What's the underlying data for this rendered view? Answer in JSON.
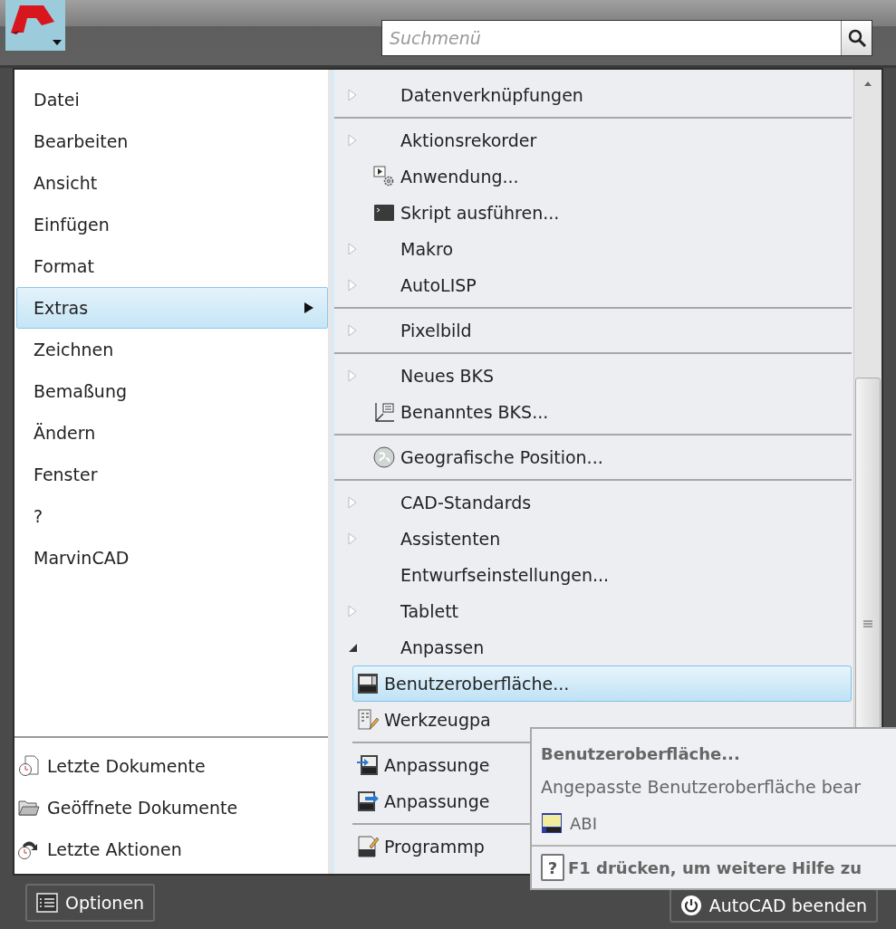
{
  "search": {
    "placeholder": "Suchmenü"
  },
  "menu": [
    {
      "label": "Datei",
      "selected": false
    },
    {
      "label": "Bearbeiten",
      "selected": false
    },
    {
      "label": "Ansicht",
      "selected": false
    },
    {
      "label": "Einfügen",
      "selected": false
    },
    {
      "label": "Format",
      "selected": false
    },
    {
      "label": "Extras",
      "selected": true
    },
    {
      "label": "Zeichnen",
      "selected": false
    },
    {
      "label": "Bemaßung",
      "selected": false
    },
    {
      "label": "Ändern",
      "selected": false
    },
    {
      "label": "Fenster",
      "selected": false
    },
    {
      "label": "?",
      "selected": false
    },
    {
      "label": "MarvinCAD",
      "selected": false
    }
  ],
  "documents": [
    {
      "label": "Letzte Dokumente"
    },
    {
      "label": "Geöffnete Dokumente"
    },
    {
      "label": "Letzte Aktionen"
    }
  ],
  "submenu": [
    {
      "kind": "submenu",
      "label": "Datenverknüpfungen",
      "selected": false
    },
    {
      "kind": "separator"
    },
    {
      "kind": "submenu",
      "label": "Aktionsrekorder",
      "selected": false
    },
    {
      "kind": "command",
      "label": "Anwendung...",
      "selected": false
    },
    {
      "kind": "command",
      "label": "Skript ausführen...",
      "selected": false
    },
    {
      "kind": "submenu",
      "label": "Makro",
      "selected": false
    },
    {
      "kind": "submenu",
      "label": "AutoLISP",
      "selected": false
    },
    {
      "kind": "separator"
    },
    {
      "kind": "submenu",
      "label": "Pixelbild",
      "selected": false
    },
    {
      "kind": "separator"
    },
    {
      "kind": "submenu",
      "label": "Neues BKS",
      "selected": false
    },
    {
      "kind": "command",
      "label": "Benanntes BKS...",
      "selected": false
    },
    {
      "kind": "separator"
    },
    {
      "kind": "command",
      "label": "Geografische Position...",
      "selected": false
    },
    {
      "kind": "separator"
    },
    {
      "kind": "submenu",
      "label": "CAD-Standards",
      "selected": false
    },
    {
      "kind": "submenu",
      "label": "Assistenten",
      "selected": false
    },
    {
      "kind": "command",
      "label": "Entwurfseinstellungen...",
      "selected": false
    },
    {
      "kind": "submenu",
      "label": "Tablett",
      "selected": false
    },
    {
      "kind": "expanded",
      "label": "Anpassen",
      "selected": false,
      "children": [
        {
          "kind": "command",
          "label": "Benutzeroberfläche...",
          "selected": true
        },
        {
          "kind": "command",
          "label": "Werkzeugpa",
          "selected": false
        },
        {
          "kind": "separator"
        },
        {
          "kind": "command",
          "label": "Anpassunge",
          "selected": false
        },
        {
          "kind": "command",
          "label": "Anpassunge",
          "selected": false
        },
        {
          "kind": "separator"
        },
        {
          "kind": "command",
          "label": "Programmp",
          "selected": false
        }
      ]
    }
  ],
  "tooltip": {
    "title": "Benutzeroberfläche...",
    "description": "Angepasste Benutzeroberfläche bear",
    "command": "ABI",
    "help_key": "?",
    "help": "F1 drücken, um weitere Hilfe zu"
  },
  "buttons": [
    {
      "label": "Optionen",
      "kind": "options"
    },
    {
      "label": "AutoCAD beenden",
      "kind": "exit"
    }
  ]
}
